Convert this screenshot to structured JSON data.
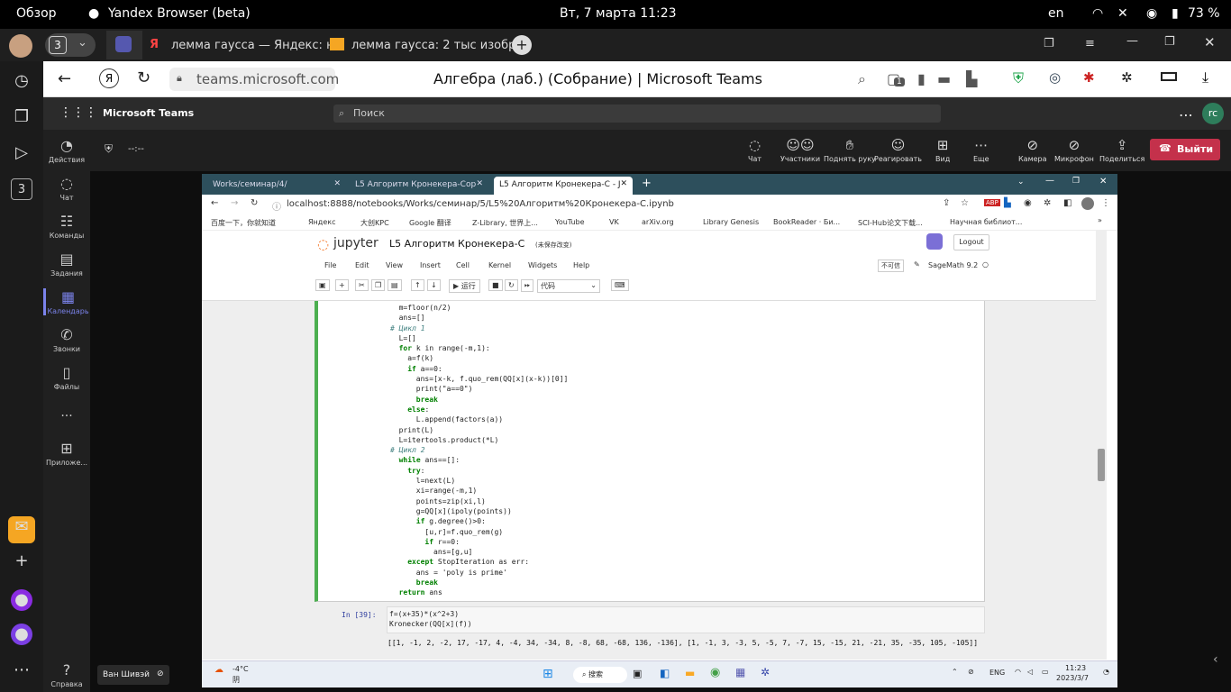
{
  "topbar": {
    "overview": "Обзор",
    "app": "Yandex Browser (beta)",
    "datetime": "Вт, 7 марта  11:23",
    "lang": "en",
    "battery": "73 %"
  },
  "browser": {
    "tab_count": "3",
    "tabs": [
      {
        "label": "лемма гаусса — Яндекс: н"
      },
      {
        "label": "лемма гаусса: 2 тыс изобр"
      }
    ],
    "url": "teams.microsoft.com",
    "page_title": "Алгебра (лаб.) (Собрание) | Microsoft Teams",
    "ext_badge": "1"
  },
  "teams": {
    "brand": "Microsoft Teams",
    "search_placeholder": "Поиск",
    "avatar_initials": "rc",
    "timer": "--:--",
    "rail": [
      {
        "icon": "bell-icon",
        "label": "Действия"
      },
      {
        "icon": "chat-icon",
        "label": "Чат"
      },
      {
        "icon": "teams-icon",
        "label": "Команды"
      },
      {
        "icon": "tasks-icon",
        "label": "Задания"
      },
      {
        "icon": "calendar-icon",
        "label": "Календарь"
      },
      {
        "icon": "phone-icon",
        "label": "Звонки"
      },
      {
        "icon": "file-icon",
        "label": "Файлы"
      },
      {
        "icon": "more-icon",
        "label": "..."
      },
      {
        "icon": "apps-icon",
        "label": "Приложе..."
      },
      {
        "icon": "help-icon",
        "label": "Справка"
      }
    ],
    "meeting_controls": [
      {
        "icon": "chat-icon",
        "label": "Чат"
      },
      {
        "icon": "people-icon",
        "label": "Участники"
      },
      {
        "icon": "hand-icon",
        "label": "Поднять руку"
      },
      {
        "icon": "smile-icon",
        "label": "Реагировать"
      },
      {
        "icon": "grid-icon",
        "label": "Вид"
      },
      {
        "icon": "more-icon",
        "label": "Еще"
      },
      {
        "icon": "camera-off-icon",
        "label": "Камера"
      },
      {
        "icon": "mic-off-icon",
        "label": "Микрофон"
      },
      {
        "icon": "share-icon",
        "label": "Поделиться"
      }
    ],
    "leave": "Выйти",
    "presenter": "Ван Шивэй"
  },
  "shared": {
    "tabs": [
      {
        "label": "Works/семинар/4/"
      },
      {
        "label": "L5 Алгоритм Кронекера-Cop"
      },
      {
        "label": "L5 Алгоритм Кронекера-С - J"
      }
    ],
    "url": "localhost:8888/notebooks/Works/семинар/5/L5%20Алгоритм%20Кронекера-C.ipynb",
    "bookmarks": [
      "百度一下，你就知道",
      "Яндекс",
      "大创KPC",
      "Google 翻译",
      "Z-Library, 世界上...",
      "YouTube",
      "VK",
      "arXiv.org",
      "Library Genesis",
      "BookReader · Би...",
      "SCI-Hub论文下载...",
      "Научная библиот..."
    ],
    "notebook_name": "L5 Алгоритм Кронекера-С",
    "notebook_status": "(未保存改变)",
    "logout": "Logout",
    "jupyter": "jupyter",
    "menu": [
      "File",
      "Edit",
      "View",
      "Insert",
      "Cell",
      "Kernel",
      "Widgets",
      "Help"
    ],
    "trust": "不可信",
    "kernel": "SageMath 9.2",
    "run_label": "运行",
    "cell_type": "代码",
    "code_lines": [
      {
        "i": 2,
        "t": "m=floor(n/2)"
      },
      {
        "i": 2,
        "t": "ans=[]"
      },
      {
        "i": 0,
        "t": "# Цикл 1",
        "c": "cm"
      },
      {
        "i": 2,
        "t": "L=[]"
      },
      {
        "i": 2,
        "t": "for k in range(-m,1):",
        "k": "for"
      },
      {
        "i": 4,
        "t": "a=f(k)"
      },
      {
        "i": 4,
        "t": "if a==0:",
        "k": "if"
      },
      {
        "i": 6,
        "t": "ans=[x-k, f.quo_rem(QQ[x](x-k))[0]]"
      },
      {
        "i": 6,
        "t": "print(\"a==0\")"
      },
      {
        "i": 6,
        "t": "break",
        "k": "break"
      },
      {
        "i": 4,
        "t": "else:",
        "k": "else"
      },
      {
        "i": 6,
        "t": "L.append(factors(a))"
      },
      {
        "i": 2,
        "t": "print(L)"
      },
      {
        "i": 2,
        "t": "L=itertools.product(*L)"
      },
      {
        "i": 0,
        "t": "# Цикл 2",
        "c": "cm"
      },
      {
        "i": 2,
        "t": "while ans==[]:",
        "k": "while"
      },
      {
        "i": 4,
        "t": "try:",
        "k": "try"
      },
      {
        "i": 6,
        "t": "l=next(L)"
      },
      {
        "i": 6,
        "t": "xi=range(-m,1)"
      },
      {
        "i": 6,
        "t": "points=zip(xi,l)"
      },
      {
        "i": 6,
        "t": "g=QQ[x](ipoly(points))"
      },
      {
        "i": 6,
        "t": "if g.degree()>0:",
        "k": "if"
      },
      {
        "i": 8,
        "t": "[u,r]=f.quo_rem(g)"
      },
      {
        "i": 8,
        "t": "if r==0:",
        "k": "if"
      },
      {
        "i": 10,
        "t": "ans=[g,u]"
      },
      {
        "i": 4,
        "t": "except StopIteration as err:",
        "k": "except"
      },
      {
        "i": 6,
        "t": "ans = 'poly is prime'"
      },
      {
        "i": 6,
        "t": "break",
        "k": "break"
      },
      {
        "i": 2,
        "t": "return ans",
        "k": "return"
      }
    ],
    "cell2_prompt": "In  [39]:",
    "cell2_lines": [
      "f=(x+35)*(x^2+3)",
      "Kronecker(QQ[x](f))"
    ],
    "output": "[[1, -1, 2, -2, 17, -17, 4, -4, 34, -34, 8, -8, 68, -68, 136, -136], [1, -1, 3, -3, 5, -5, 7, -7, 15, -15, 21, -21, 35, -35, 105, -105]]",
    "win_taskbar": {
      "weather_temp": "-4°C",
      "weather_desc": "阴",
      "search": "搜索",
      "lang": "ENG",
      "time": "11:23",
      "date": "2023/3/7"
    }
  }
}
